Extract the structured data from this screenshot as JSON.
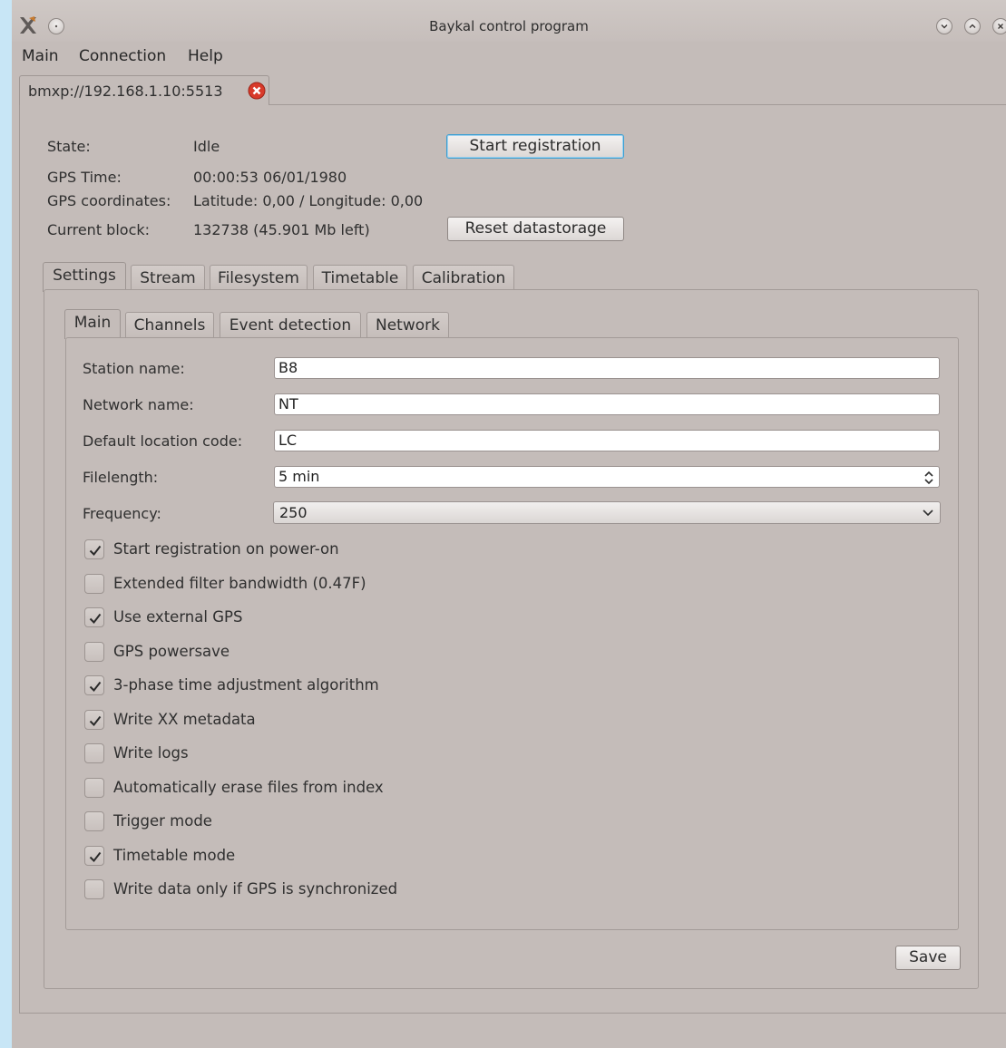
{
  "window": {
    "title": "Baykal control program"
  },
  "menubar": {
    "items": [
      "Main",
      "Connection",
      "Help"
    ]
  },
  "connection_tab": {
    "label": "bmxp://192.168.1.10:5513"
  },
  "status": {
    "state_label": "State:",
    "state_value": "Idle",
    "gps_time_label": "GPS Time:",
    "gps_time_value": "00:00:53 06/01/1980",
    "gps_coords_label": "GPS coordinates:",
    "gps_coords_value": "Latitude: 0,00 / Longitude: 0,00",
    "block_label": "Current block:",
    "block_value": "132738 (45.901 Mb left)",
    "start_button": "Start registration",
    "reset_button": "Reset datastorage"
  },
  "outer_tabs": [
    "Settings",
    "Stream",
    "Filesystem",
    "Timetable",
    "Calibration"
  ],
  "inner_tabs": [
    "Main",
    "Channels",
    "Event detection",
    "Network"
  ],
  "settings_main": {
    "station_name_label": "Station name:",
    "station_name_value": "B8",
    "network_name_label": "Network name:",
    "network_name_value": "NT",
    "location_code_label": "Default location code:",
    "location_code_value": "LC",
    "filelength_label": "Filelength:",
    "filelength_value": "5 min",
    "frequency_label": "Frequency:",
    "frequency_value": "250",
    "checkboxes": [
      {
        "label": "Start registration on power-on",
        "checked": true
      },
      {
        "label": "Extended filter bandwidth (0.47F)",
        "checked": false
      },
      {
        "label": "Use external GPS",
        "checked": true
      },
      {
        "label": "GPS powersave",
        "checked": false
      },
      {
        "label": "3-phase time adjustment algorithm",
        "checked": true
      },
      {
        "label": "Write XX metadata",
        "checked": true
      },
      {
        "label": "Write logs",
        "checked": false
      },
      {
        "label": "Automatically erase files from index",
        "checked": false
      },
      {
        "label": "Trigger mode",
        "checked": false
      },
      {
        "label": "Timetable mode",
        "checked": true
      },
      {
        "label": "Write data only if GPS is synchronized",
        "checked": false
      }
    ]
  },
  "save_button": "Save",
  "colors": {
    "window_bg": "#c4bcb9",
    "focus_accent": "#3d9fd1",
    "close_red": "#d83a2a"
  }
}
